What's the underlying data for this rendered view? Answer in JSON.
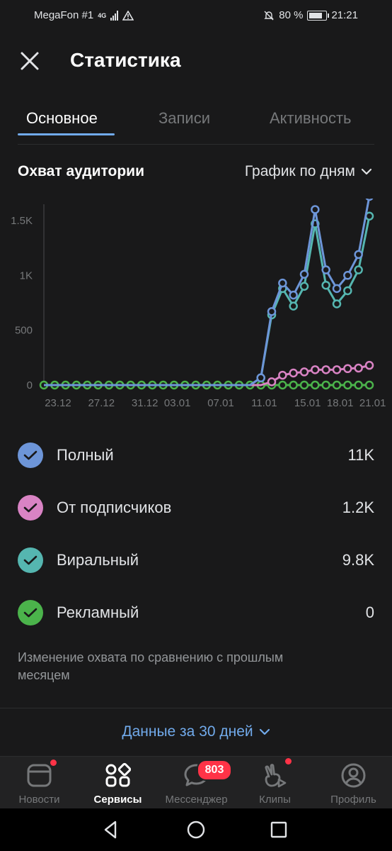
{
  "status_bar": {
    "carrier": "MegaFon #1",
    "network": "4G",
    "battery": "80 %",
    "time": "21:21"
  },
  "header": {
    "title": "Статистика",
    "close_icon": "close-icon"
  },
  "tabs": [
    {
      "label": "Основное",
      "active": true
    },
    {
      "label": "Записи",
      "active": false
    },
    {
      "label": "Активность",
      "active": false
    }
  ],
  "section": {
    "title": "Охват аудитории",
    "period_selector": "График по дням"
  },
  "chart_data": {
    "type": "line",
    "x_ticks": [
      "23.12",
      "27.12",
      "31.12",
      "03.01",
      "07.01",
      "11.01",
      "15.01",
      "18.01",
      "21.01"
    ],
    "y_ticks": [
      "0",
      "500",
      "1K",
      "1.5K"
    ],
    "ylim": [
      0,
      1700
    ],
    "x_count": 31,
    "series": [
      {
        "name": "Полный",
        "color": "#6d95d8",
        "values": [
          0,
          0,
          0,
          0,
          0,
          0,
          0,
          0,
          0,
          0,
          0,
          0,
          0,
          0,
          0,
          0,
          0,
          0,
          0,
          0,
          66,
          670,
          930,
          820,
          1010,
          1600,
          1050,
          880,
          1000,
          1190,
          1720
        ]
      },
      {
        "name": "Вирaльный",
        "color": "#55b6b0",
        "values": [
          0,
          0,
          0,
          0,
          0,
          0,
          0,
          0,
          0,
          0,
          0,
          0,
          0,
          0,
          0,
          0,
          0,
          0,
          0,
          0,
          66,
          640,
          880,
          720,
          900,
          1470,
          910,
          740,
          860,
          1050,
          1540
        ]
      },
      {
        "name": "От подписчиков",
        "color": "#d983c4",
        "values": [
          0,
          0,
          0,
          0,
          0,
          0,
          0,
          0,
          0,
          0,
          0,
          0,
          0,
          0,
          0,
          0,
          0,
          0,
          0,
          0,
          0,
          30,
          90,
          110,
          120,
          140,
          140,
          140,
          150,
          155,
          180
        ]
      },
      {
        "name": "Рекламный",
        "color": "#4bb34b",
        "values": [
          0,
          0,
          0,
          0,
          0,
          0,
          0,
          0,
          0,
          0,
          0,
          0,
          0,
          0,
          0,
          0,
          0,
          0,
          0,
          0,
          0,
          0,
          0,
          0,
          0,
          0,
          0,
          0,
          0,
          0,
          0
        ]
      }
    ]
  },
  "legend": [
    {
      "label": "Полный",
      "value": "11K",
      "color": "#6d95d8"
    },
    {
      "label": "От подписчиков",
      "value": "1.2K",
      "color": "#d983c4"
    },
    {
      "label": "Вирaльный",
      "value": "9.8K",
      "color": "#55b6b0"
    },
    {
      "label": "Рекламный",
      "value": "0",
      "color": "#4bb34b"
    }
  ],
  "note": "Изменение охвата по сравнению с прошлым месяцем",
  "data_range": "Данные за 30 дней",
  "bottom_nav": [
    {
      "label": "Новости",
      "icon": "news-icon",
      "dot": true
    },
    {
      "label": "Сервисы",
      "icon": "services-icon",
      "active": true
    },
    {
      "label": "Мессенджер",
      "icon": "messenger-icon",
      "badge": "803"
    },
    {
      "label": "Клипы",
      "icon": "clips-icon",
      "dot": true
    },
    {
      "label": "Профиль",
      "icon": "profile-icon"
    }
  ]
}
